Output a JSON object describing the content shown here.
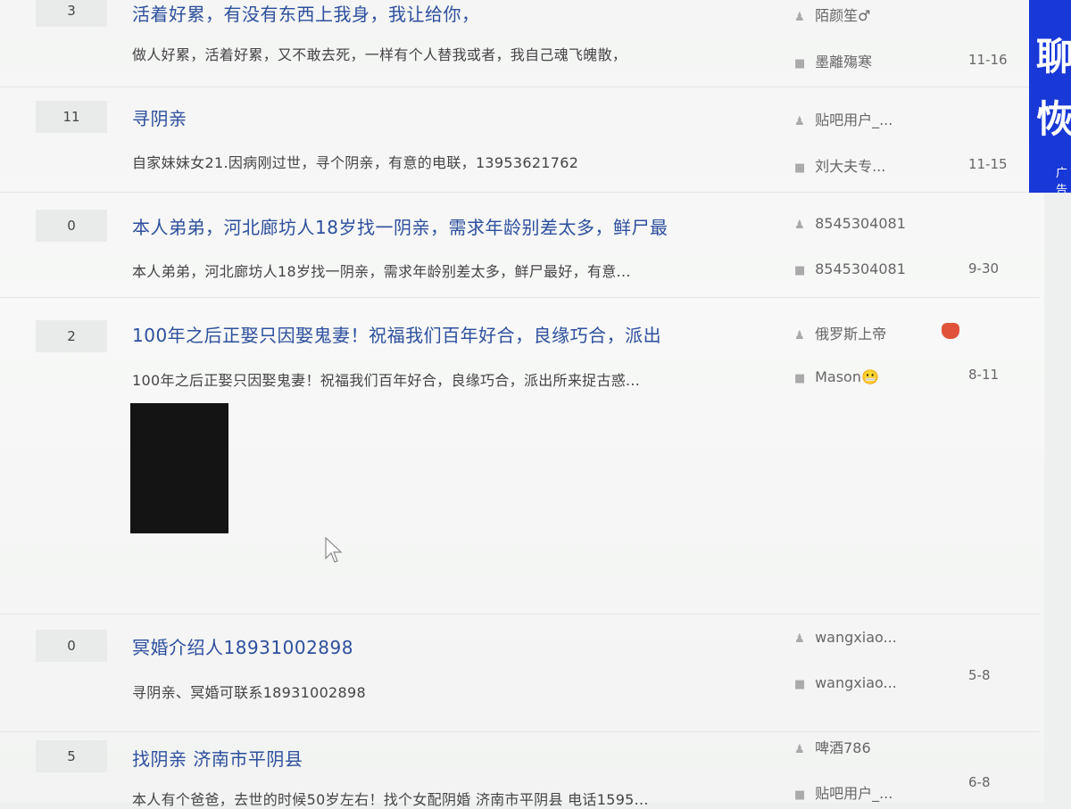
{
  "ad": {
    "line1": "聊",
    "line2": "恢",
    "tag": "广告"
  },
  "threads": [
    {
      "replies": "3",
      "title": "活着好累，有没有东西上我身，我让给你，",
      "abstract": "做人好累，活着好累，又不敢去死，一样有个人替我或者，我自己魂飞魄散，",
      "author": "陌颜笙♂",
      "last_reply": "墨離殤寒",
      "date": "11-16"
    },
    {
      "replies": "11",
      "title": "寻阴亲",
      "abstract": "自家妹妹女21.因病刚过世，寻个阴亲，有意的电联，13953621762",
      "author": "贴吧用户_...",
      "last_reply": "刘大夫专...",
      "date": "11-15"
    },
    {
      "replies": "0",
      "title": "本人弟弟，河北廊坊人18岁找一阴亲，需求年龄别差太多，鲜尸最",
      "abstract": "本人弟弟，河北廊坊人18岁找一阴亲，需求年龄别差太多，鲜尸最好，有意...",
      "author": "8545304081",
      "last_reply": "8545304081",
      "date": "9-30"
    },
    {
      "replies": "2",
      "title": "100年之后正娶只因娶鬼妻！祝福我们百年好合，良缘巧合，派出",
      "abstract": "100年之后正娶只因娶鬼妻！祝福我们百年好合，良缘巧合，派出所来捉古惑...",
      "author": "俄罗斯上帝",
      "last_reply": "Mason😬",
      "date": "8-11"
    },
    {
      "replies": "0",
      "title": "冥婚介绍人18931002898",
      "abstract": "寻阴亲、冥婚可联系18931002898",
      "author": "wangxiao...",
      "last_reply": "wangxiao...",
      "date": "5-8"
    },
    {
      "replies": "5",
      "title": "找阴亲 济南市平阴县",
      "abstract": "本人有个爸爸，去世的时候50岁左右！找个女配阴婚 济南市平阴县 电话1595...",
      "author": "啤酒786",
      "last_reply": "贴吧用户_...",
      "date": "6-8"
    }
  ]
}
